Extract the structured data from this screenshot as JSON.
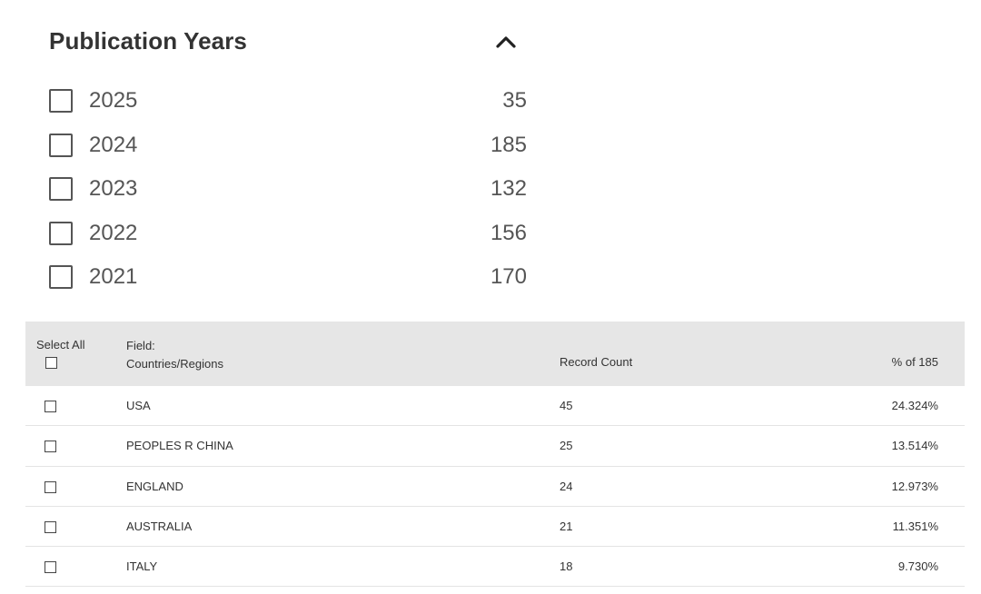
{
  "facet": {
    "title": "Publication Years",
    "toggle_icon": "chevron-up-icon",
    "items": [
      {
        "label": "2025",
        "count": "35",
        "checked": false
      },
      {
        "label": "2024",
        "count": "185",
        "checked": false
      },
      {
        "label": "2023",
        "count": "132",
        "checked": false
      },
      {
        "label": "2022",
        "count": "156",
        "checked": false
      },
      {
        "label": "2021",
        "count": "170",
        "checked": false
      }
    ]
  },
  "table": {
    "header": {
      "select_all": "Select All",
      "field_label": "Field:",
      "field_name": "Countries/Regions",
      "record_count": "Record Count",
      "percent": "% of 185"
    },
    "rows": [
      {
        "name": "USA",
        "count": "45",
        "percent": "24.324%",
        "checked": false
      },
      {
        "name": "PEOPLES R CHINA",
        "count": "25",
        "percent": "13.514%",
        "checked": false
      },
      {
        "name": "ENGLAND",
        "count": "24",
        "percent": "12.973%",
        "checked": false
      },
      {
        "name": "AUSTRALIA",
        "count": "21",
        "percent": "11.351%",
        "checked": false
      },
      {
        "name": "ITALY",
        "count": "18",
        "percent": "9.730%",
        "checked": false
      }
    ]
  },
  "colors": {
    "header_background": "#e6e6e6",
    "text": "#333333",
    "facet_text": "#555555",
    "row_divider": "#e4e4e4"
  }
}
